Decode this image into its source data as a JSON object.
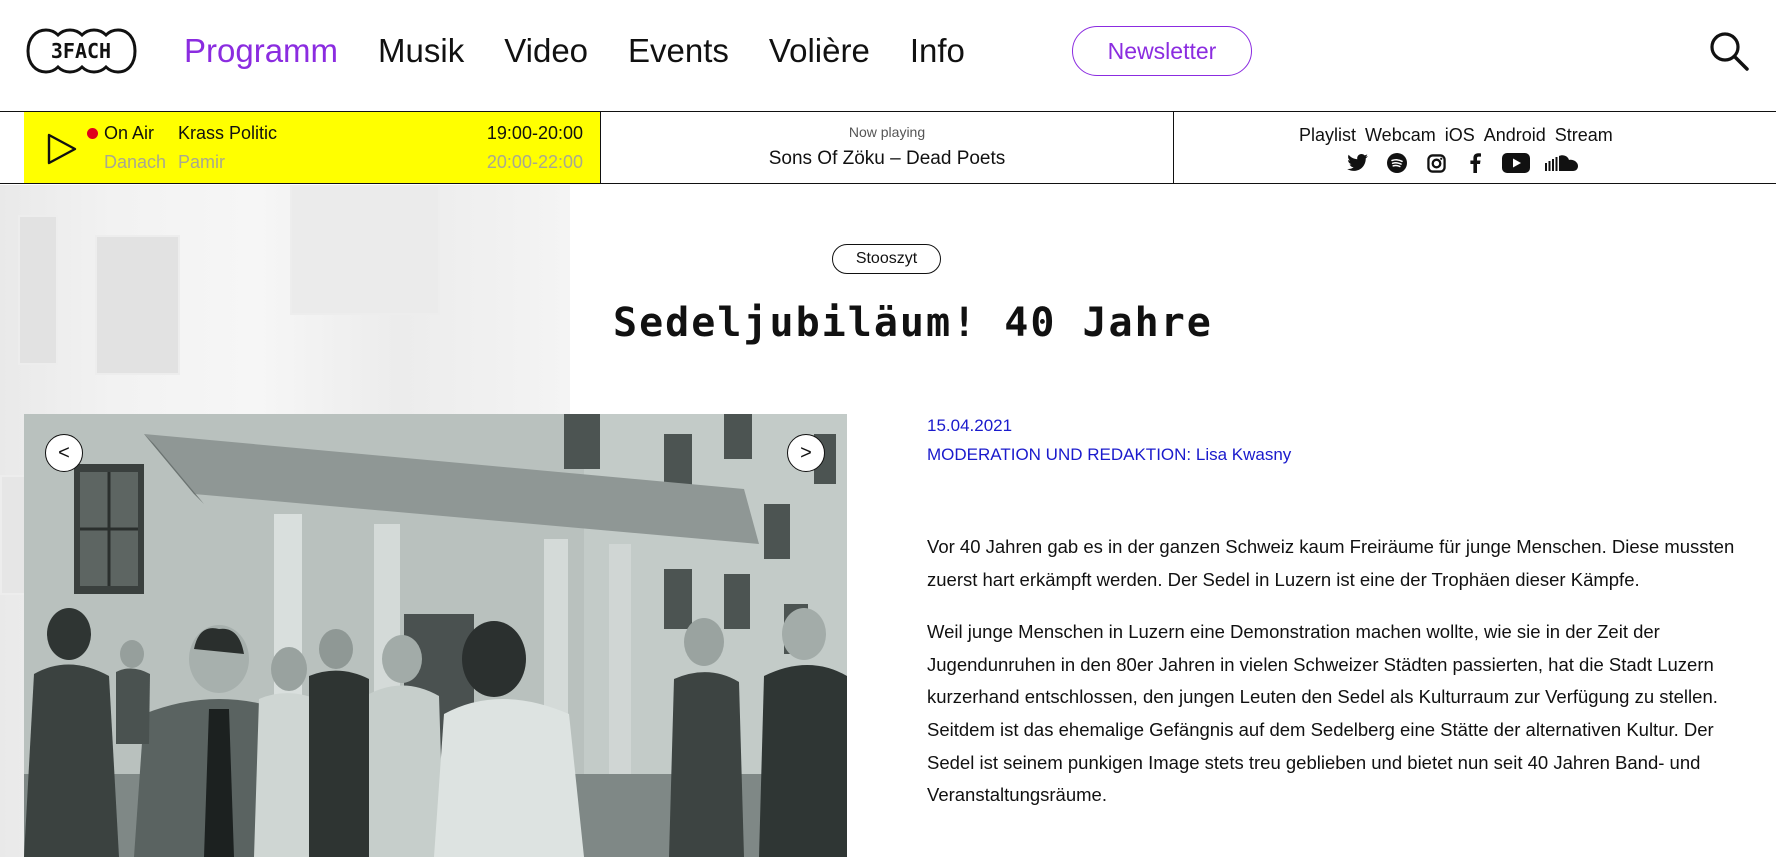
{
  "header": {
    "logo_text": "3FACH",
    "nav": [
      {
        "label": "Programm",
        "active": true
      },
      {
        "label": "Musik",
        "active": false
      },
      {
        "label": "Video",
        "active": false
      },
      {
        "label": "Events",
        "active": false
      },
      {
        "label": "Volière",
        "active": false
      },
      {
        "label": "Info",
        "active": false
      }
    ],
    "newsletter_label": "Newsletter",
    "accent_color": "#8b2ce0"
  },
  "radio": {
    "on_air_label": "On Air",
    "on_air_show": "Krass Politic",
    "on_air_time": "19:00-20:00",
    "next_label": "Danach",
    "next_show": "Pamir",
    "next_time": "20:00-22:00",
    "now_playing_label": "Now playing",
    "now_playing_track": "Sons Of Zöku – Dead Poets",
    "links": [
      "Playlist",
      "Webcam",
      "iOS",
      "Android",
      "Stream"
    ],
    "social_icons": [
      "twitter-icon",
      "spotify-icon",
      "instagram-icon",
      "facebook-icon",
      "youtube-icon",
      "soundcloud-icon"
    ],
    "bar_color": "#ffff00"
  },
  "article": {
    "tag": "Stooszyt",
    "title": "Sedeljubiläum! 40 Jahre",
    "date": "15.04.2021",
    "moderation": "MODERATION UND REDAKTION: Lisa Kwasny",
    "paragraphs": [
      "Vor 40 Jahren gab es in der ganzen Schweiz kaum Freiräume für junge Menschen. Diese mussten zuerst hart erkämpft werden. Der Sedel in Luzern ist eine der Trophäen dieser Kämpfe.",
      "Weil junge Menschen in Luzern eine Demonstration machen wollte, wie sie in der Zeit der Jugendunruhen in den 80er Jahren in vielen Schweizer Städten passierten, hat die Stadt Luzern kurzerhand entschlossen, den jungen Leuten den Sedel als Kulturraum zur Verfügung zu stellen. Seitdem ist das ehemalige Gefängnis auf dem Sedelberg eine Stätte der alternativen Kultur. Der Sedel ist seinem punkigen Image stets treu geblieben und bietet nun seit 40 Jahren Band- und Veranstaltungsräume."
    ],
    "meta_color": "#1a1acc"
  },
  "gallery": {
    "prev_label": "<",
    "next_label": ">"
  }
}
